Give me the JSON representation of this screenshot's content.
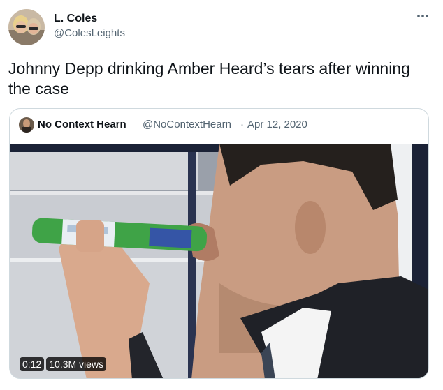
{
  "author": {
    "name": "L. Coles",
    "handle": "@ColesLeights"
  },
  "more_icon": "more-options-icon",
  "tweet_text": "Johnny Depp drinking Amber Heard’s tears after winning the case",
  "quoted": {
    "name": "No Context Hearn",
    "handle": "@NoContextHearn",
    "separator": "·",
    "date": "Apr 12, 2020",
    "video": {
      "time": "0:12",
      "views": "10.3M views"
    }
  },
  "colors": {
    "text": "#0f1419",
    "secondary": "#536471",
    "border": "#cfd9de"
  }
}
